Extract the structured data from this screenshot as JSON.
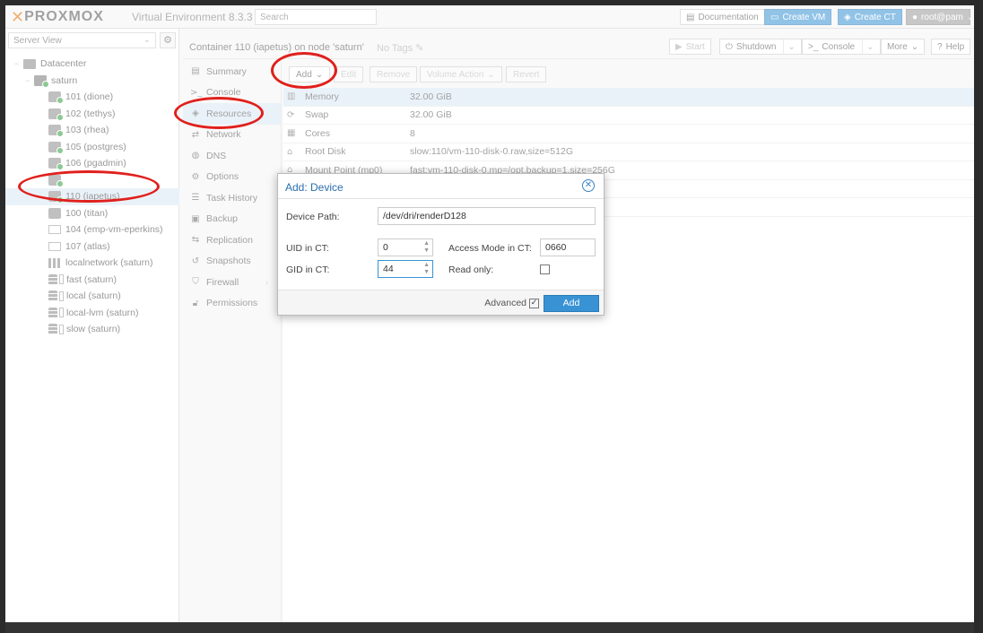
{
  "header": {
    "brand": "PROXMOX",
    "product": "Virtual Environment 8.3.3",
    "search_placeholder": "Search",
    "documentation": "Documentation",
    "create_vm": "Create VM",
    "create_ct": "Create CT",
    "user": "root@pam"
  },
  "sidebar": {
    "view": "Server View",
    "items": [
      {
        "label": "Datacenter"
      },
      {
        "label": "saturn"
      },
      {
        "label": "101 (dione)"
      },
      {
        "label": "102 (tethys)"
      },
      {
        "label": "103 (rhea)"
      },
      {
        "label": "105 (postgres)"
      },
      {
        "label": "106 (pgadmin)"
      },
      {
        "label": ""
      },
      {
        "label": "110 (iapetus)"
      },
      {
        "label": "100 (titan)"
      },
      {
        "label": "104 (emp-vm-eperkins)"
      },
      {
        "label": "107 (atlas)"
      },
      {
        "label": "localnetwork (saturn)"
      },
      {
        "label": "fast (saturn)"
      },
      {
        "label": "local (saturn)"
      },
      {
        "label": "local-lvm (saturn)"
      },
      {
        "label": "slow (saturn)"
      }
    ]
  },
  "content": {
    "title": "Container 110 (iapetus) on node 'saturn'",
    "tags": "No Tags",
    "start": "Start",
    "shutdown": "Shutdown",
    "console": "Console",
    "more": "More",
    "help": "Help"
  },
  "subnav": {
    "items": [
      {
        "label": "Summary",
        "icon": "book-icon"
      },
      {
        "label": "Console",
        "icon": "terminal-icon"
      },
      {
        "label": "Resources",
        "icon": "cube-icon"
      },
      {
        "label": "Network",
        "icon": "exchange-icon"
      },
      {
        "label": "DNS",
        "icon": "globe-icon"
      },
      {
        "label": "Options",
        "icon": "gear-icon"
      },
      {
        "label": "Task History",
        "icon": "list-icon"
      },
      {
        "label": "Backup",
        "icon": "floppy-icon"
      },
      {
        "label": "Replication",
        "icon": "retweet-icon"
      },
      {
        "label": "Snapshots",
        "icon": "history-icon"
      },
      {
        "label": "Firewall",
        "icon": "shield-icon"
      },
      {
        "label": "Permissions",
        "icon": "unlock-icon"
      }
    ]
  },
  "toolbar": {
    "add": "Add",
    "edit": "Edit",
    "remove": "Remove",
    "volume_action": "Volume Action",
    "revert": "Revert"
  },
  "resources": [
    {
      "key": "Memory",
      "value": "32.00 GiB",
      "icon": "memory-icon"
    },
    {
      "key": "Swap",
      "value": "32.00 GiB",
      "icon": "refresh-icon"
    },
    {
      "key": "Cores",
      "value": "8",
      "icon": "cpu-icon"
    },
    {
      "key": "Root Disk",
      "value": "slow:110/vm-110-disk-0.raw,size=512G",
      "icon": "hdd-icon"
    },
    {
      "key": "Mount Point (mp0)",
      "value": "fast:vm-110-disk-0,mp=/opt,backup=1,size=256G",
      "icon": "hdd-icon"
    }
  ],
  "dialog": {
    "title": "Add: Device",
    "device_path_label": "Device Path:",
    "device_path_value": "/dev/dri/renderD128",
    "uid_label": "UID in CT:",
    "uid_value": "0",
    "gid_label": "GID in CT:",
    "gid_value": "44",
    "access_mode_label": "Access Mode in CT:",
    "access_mode_value": "0660",
    "read_only_label": "Read only:",
    "advanced_label": "Advanced",
    "add_button": "Add"
  }
}
